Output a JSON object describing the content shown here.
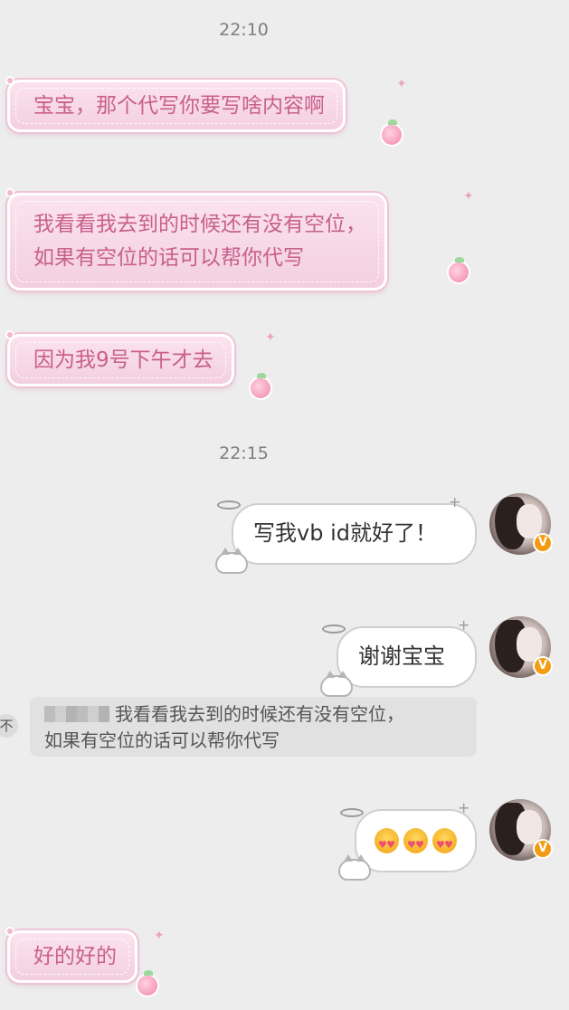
{
  "timestamps": [
    "22:10",
    "22:15"
  ],
  "messages": {
    "m1": "宝宝，那个代写你要写啥内容啊",
    "m2_line1": "我看看我去到的时候还有没有空位，",
    "m2_line2": "如果有空位的话可以帮你代写",
    "m3": "因为我9号下午才去",
    "m4": "写我vb id就好了！",
    "m5": "谢谢宝宝",
    "m7": "好的好的"
  },
  "quote": {
    "line1": "我看看我去到的时候还有没有空位，",
    "line2": "如果有空位的话可以帮你代写",
    "sender_blurred": true
  },
  "edge_tag": "不",
  "avatar_badge": "V",
  "emoji_reaction": [
    "smiling-face-with-heart-eyes",
    "smiling-face-with-heart-eyes",
    "smiling-face-with-heart-eyes"
  ],
  "colors": {
    "background": "#ededed",
    "pink_text": "#c8608a",
    "pink_bubble": "#f3cfe0",
    "white_bubble": "#ffffff",
    "badge": "#f39b12"
  }
}
